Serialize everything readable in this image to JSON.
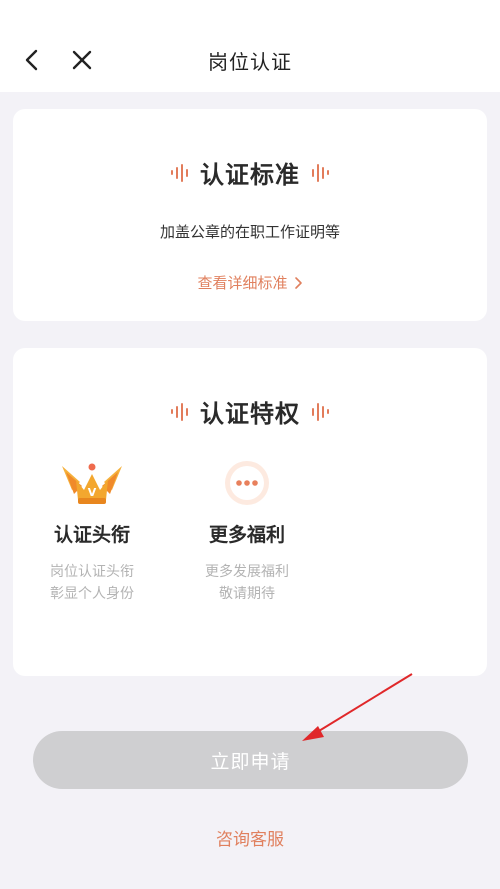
{
  "header": {
    "title": "岗位认证"
  },
  "standard": {
    "title": "认证标准",
    "description": "加盖公章的在职工作证明等",
    "detail_link": "查看详细标准"
  },
  "privileges": {
    "title": "认证特权",
    "items": [
      {
        "name": "认证头衔",
        "desc_line1": "岗位认证头衔",
        "desc_line2": "彰显个人身份",
        "icon": "crown-v-icon"
      },
      {
        "name": "更多福利",
        "desc_line1": "更多发展福利",
        "desc_line2": "敬请期待",
        "icon": "more-dots-icon"
      }
    ]
  },
  "apply_button": {
    "label": "立即申请"
  },
  "service_link": {
    "label": "咨询客服"
  },
  "colors": {
    "accent": "#e0805e",
    "button_disabled": "#cfcfd1",
    "annotation_arrow": "#e0282a"
  }
}
